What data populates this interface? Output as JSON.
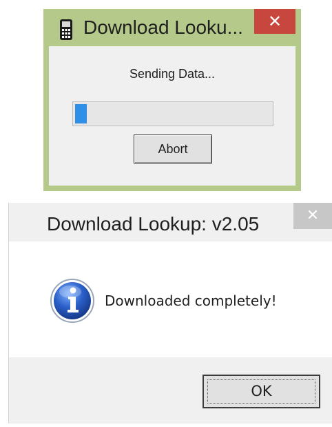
{
  "progress_dialog": {
    "title": "Download Looku...",
    "close_glyph": "✕",
    "status": "Sending Data...",
    "progress_fraction": 0.06,
    "abort_label": "Abort",
    "icon": "handheld-scanner-icon"
  },
  "message_dialog": {
    "title": "Download Lookup: v2.05",
    "close_glyph": "✕",
    "message": "Downloaded completely!",
    "ok_label": "OK",
    "icon": "info-icon"
  },
  "colors": {
    "progress_frame": "#b5c98a",
    "close_active": "#c7473f",
    "close_inactive": "#c7c7c7",
    "progress_fill": "#2f8fe7"
  }
}
